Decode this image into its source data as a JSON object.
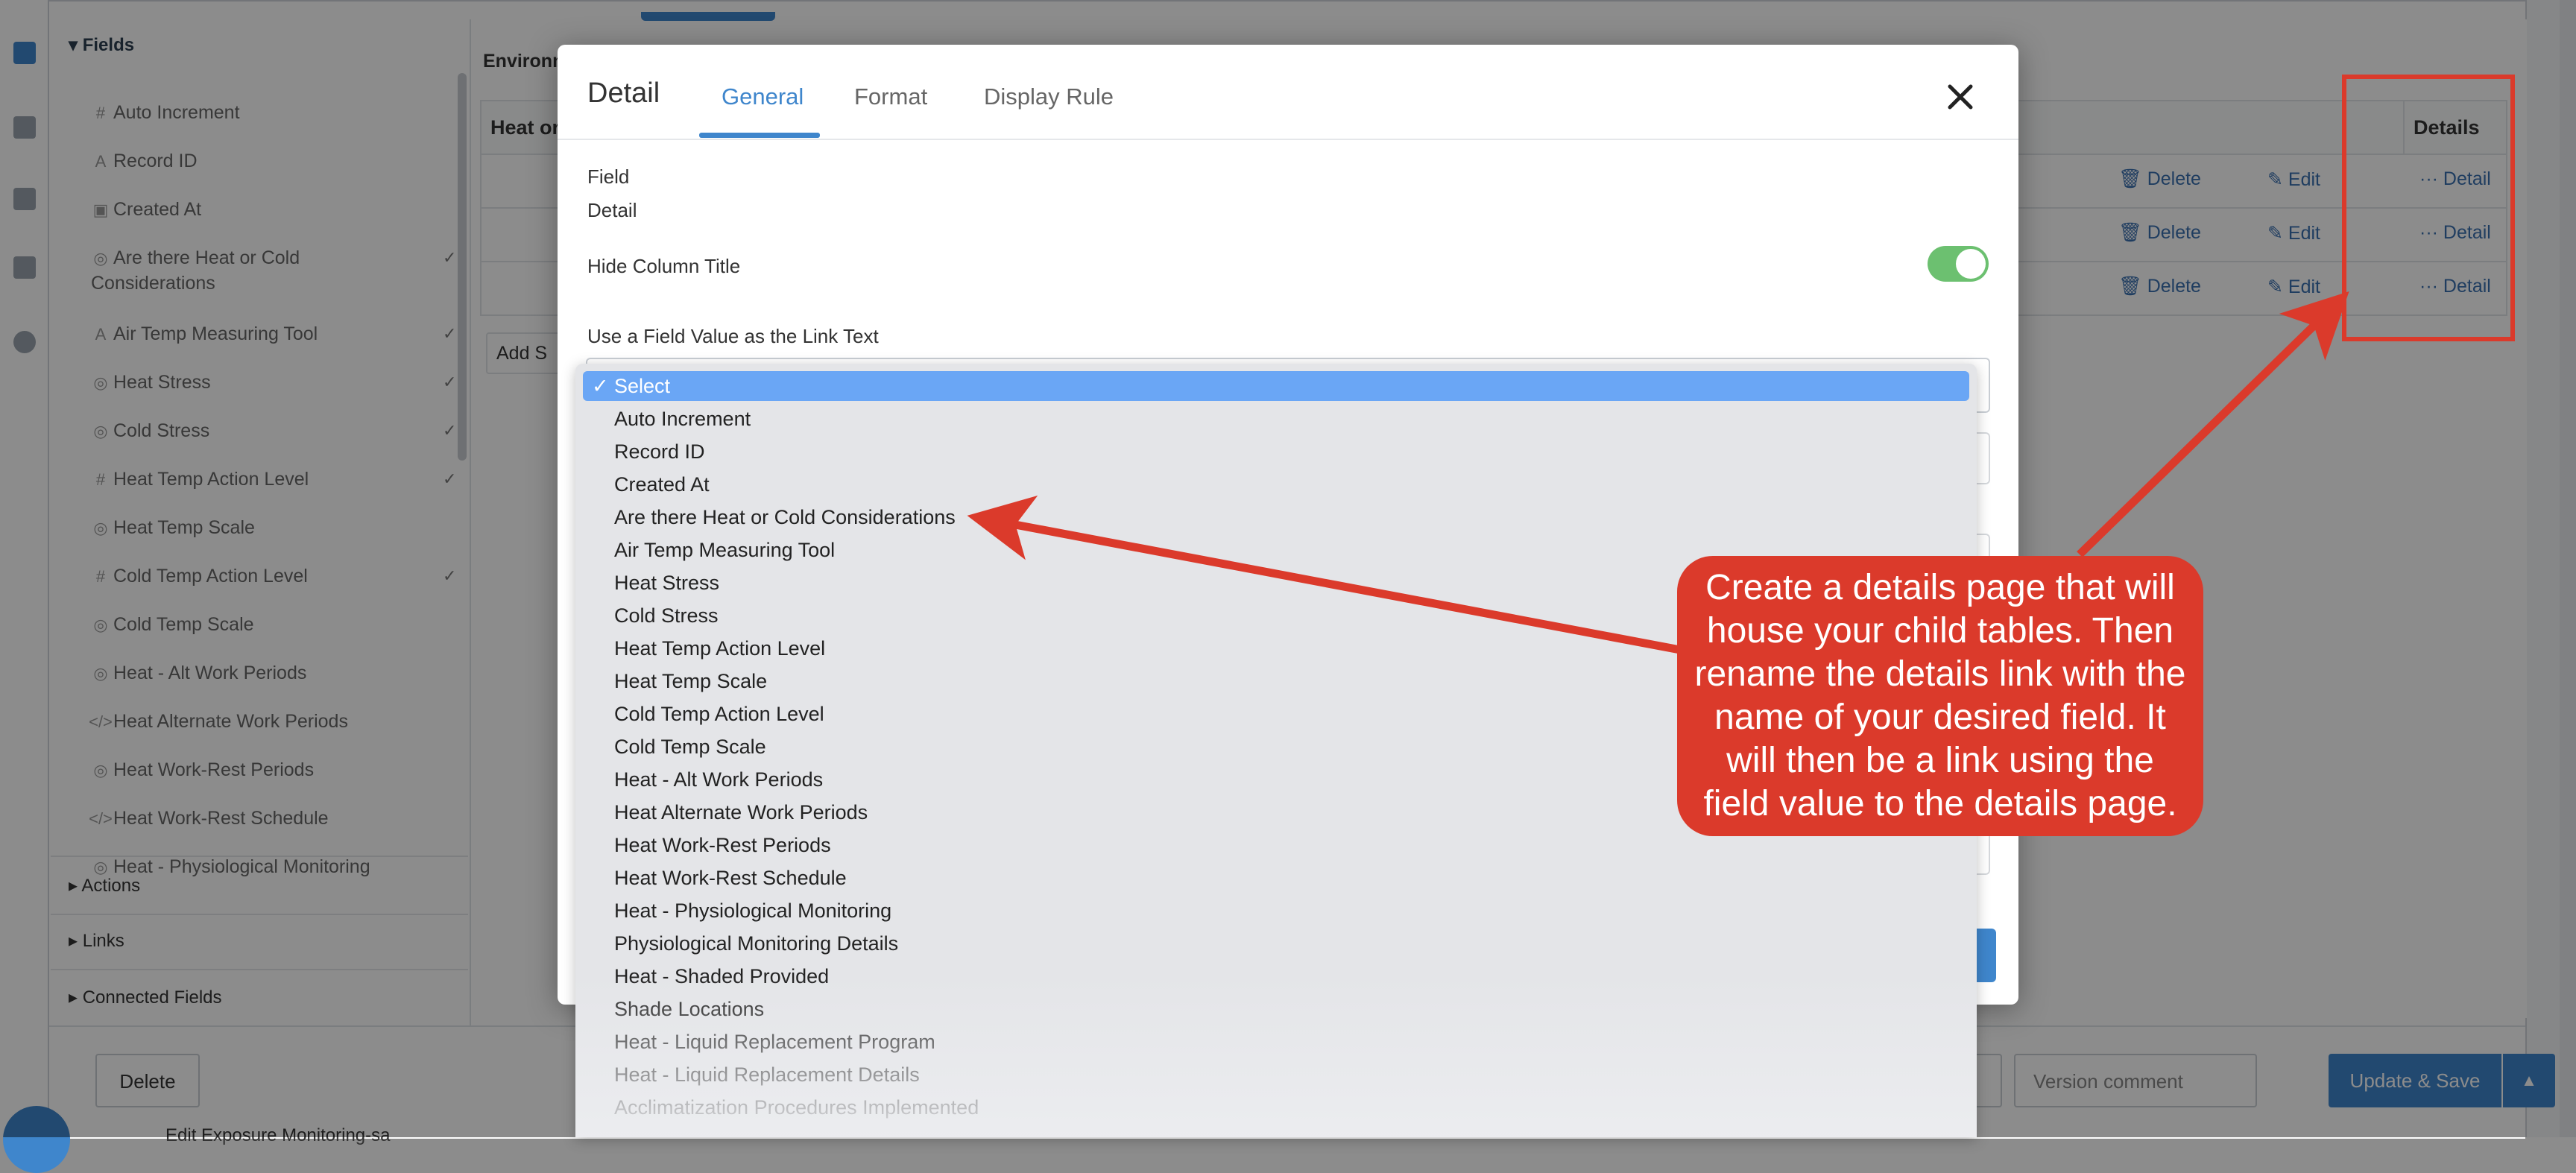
{
  "background": {
    "fields_panel": {
      "header": "Fields",
      "items": [
        {
          "icon": "#",
          "label": "Auto Increment",
          "checked": false
        },
        {
          "icon": "A",
          "label": "Record ID",
          "checked": false
        },
        {
          "icon": "▣",
          "label": "Created At",
          "checked": false
        },
        {
          "icon": "◎",
          "label": "Are there Heat or Cold",
          "label2": "Considerations",
          "checked": true
        },
        {
          "icon": "A",
          "label": "Air Temp Measuring Tool",
          "checked": true
        },
        {
          "icon": "◎",
          "label": "Heat Stress",
          "checked": true
        },
        {
          "icon": "◎",
          "label": "Cold Stress",
          "checked": true
        },
        {
          "icon": "#",
          "label": "Heat Temp Action Level",
          "checked": true
        },
        {
          "icon": "◎",
          "label": "Heat Temp Scale",
          "checked": false
        },
        {
          "icon": "#",
          "label": "Cold Temp Action Level",
          "checked": true
        },
        {
          "icon": "◎",
          "label": "Cold Temp Scale",
          "checked": false
        },
        {
          "icon": "◎",
          "label": "Heat - Alt Work Periods",
          "checked": false
        },
        {
          "icon": "</>",
          "label": "Heat Alternate Work Periods",
          "checked": false
        },
        {
          "icon": "◎",
          "label": "Heat Work-Rest Periods",
          "checked": false
        },
        {
          "icon": "</>",
          "label": "Heat Work-Rest Schedule",
          "checked": false
        },
        {
          "icon": "◎",
          "label": "Heat - Physiological Monitoring",
          "checked": false
        }
      ],
      "check_glyph": "✓",
      "sections": [
        "Actions",
        "Links",
        "Connected Fields"
      ]
    },
    "canvas": {
      "section_label": "Environm",
      "col_header": "Heat or",
      "details_header": "Details",
      "add_label": "Add S",
      "rows": [
        {
          "delete": "Delete",
          "edit": "Edit",
          "detail": "Detail"
        },
        {
          "delete": "Delete",
          "edit": "Edit",
          "detail": "Detail"
        },
        {
          "delete": "Delete",
          "edit": "Edit",
          "detail": "Detail"
        }
      ]
    },
    "bottom_bar": {
      "delete_label": "Delete",
      "version_placeholder": "Version comment",
      "update_label": "Update & Save",
      "caret": "▲",
      "footer_text": "Edit Exposure Monitoring-sa"
    }
  },
  "modal": {
    "title": "Detail",
    "tabs": [
      {
        "label": "General",
        "active": true
      },
      {
        "label": "Format",
        "active": false
      },
      {
        "label": "Display Rule",
        "active": false
      }
    ],
    "close_icon": "×",
    "field_label": "Field",
    "field_value": "Detail",
    "hide_column_title_label": "Hide Column Title",
    "hide_column_title_on": true,
    "link_text_label": "Use a Field Value as the Link Text"
  },
  "dropdown": {
    "check_mark": "✓",
    "options": [
      "Select",
      "Auto Increment",
      "Record ID",
      "Created At",
      "Are there Heat or Cold Considerations",
      "Air Temp Measuring Tool",
      "Heat Stress",
      "Cold Stress",
      "Heat Temp Action Level",
      "Heat Temp Scale",
      "Cold Temp Action Level",
      "Cold Temp Scale",
      "Heat - Alt Work Periods",
      "Heat Alternate Work Periods",
      "Heat Work-Rest Periods",
      "Heat Work-Rest Schedule",
      "Heat - Physiological Monitoring",
      "Physiological Monitoring Details",
      "Heat - Shaded Provided",
      "Shade Locations",
      "Heat - Liquid Replacement Program",
      "Heat - Liquid Replacement Details",
      "Acclimatization Procedures Implemented"
    ],
    "selected_index": 0
  },
  "annotation": {
    "callout_text": "Create a details page that will house your child tables. Then rename the details link with the name of your desired field. It will then be a link using the field value to the details page.",
    "color": "#db3a2b"
  },
  "colors": {
    "accent": "#3f86cc",
    "toggle_on": "#6cc070",
    "selected_option": "#6aa6f5"
  }
}
